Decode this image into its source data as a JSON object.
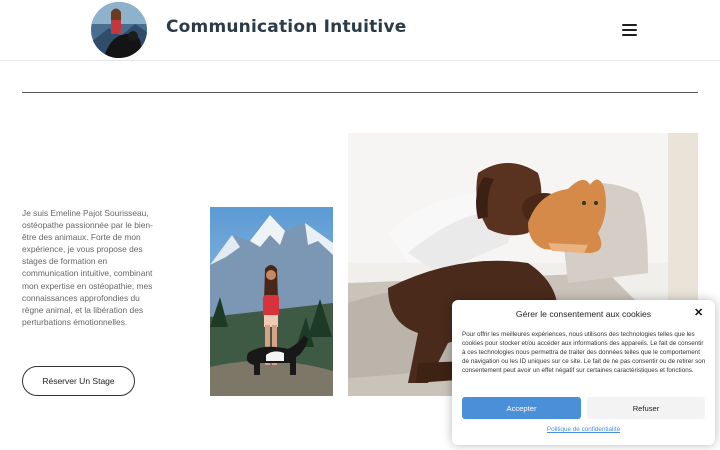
{
  "header": {
    "title": "Communication Intuitive",
    "logo_icon": "avatar-woman-with-dog",
    "menu_icon": "hamburger-menu-icon"
  },
  "intro": {
    "text": "Je suis Emeline Pajot Sourisseau, ostéopathe passionnée par le bien-être des animaux. Forte de mon expérience, je vous propose des stages de formation en communication intuitive, combinant mon expertise en ostéopathie, mes connaissances approfondies du règne animal, et la libération des perturbations émotionnelles.",
    "cta_label": "Réserver Un Stage"
  },
  "images": {
    "left_photo": "woman-with-dog-in-mountains",
    "right_photo": "dog-and-cat-on-sofa"
  },
  "consent": {
    "title": "Gérer le consentement aux cookies",
    "close_icon": "close-icon",
    "body": "Pour offrir les meilleures expériences, nous utilisons des technologies telles que les cookies pour stocker et/ou accéder aux informations des appareils. Le fait de consentir à ces technologies nous permettra de traiter des données telles que le comportement de navigation ou les ID uniques sur ce site. Le fait de ne pas consentir ou de retirer son consentement peut avoir un effet négatif sur certaines caractéristiques et fonctions.",
    "accept_label": "Accepter",
    "refuse_label": "Refuser",
    "privacy_label": "Politique de confidentialité"
  },
  "colors": {
    "title": "#2b3b47",
    "accept": "#4a90d9",
    "refuse": "#f3f3f3",
    "link": "#4a90d9"
  }
}
